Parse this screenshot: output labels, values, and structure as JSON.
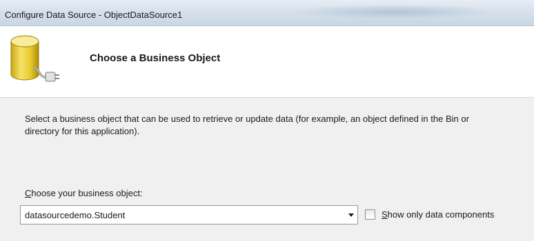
{
  "window": {
    "title": "Configure Data Source - ObjectDataSource1"
  },
  "header": {
    "heading": "Choose a Business Object",
    "icon": "database-connect-icon"
  },
  "content": {
    "description_line1": "Select a business object that can be used to retrieve or update data (for example, an object defined in the Bin or",
    "description_line2": "directory for this application).",
    "business_object_label": "Choose your business object:",
    "business_object_selected": "datasourcedemo.Student",
    "show_only_data_components_label": "Show only data components",
    "show_only_data_components_checked": false
  },
  "colors": {
    "titlebar": "#d4dfea",
    "header_bg": "#ffffff",
    "content_bg": "#f0f0f0",
    "combo_border": "#8e99a5"
  }
}
